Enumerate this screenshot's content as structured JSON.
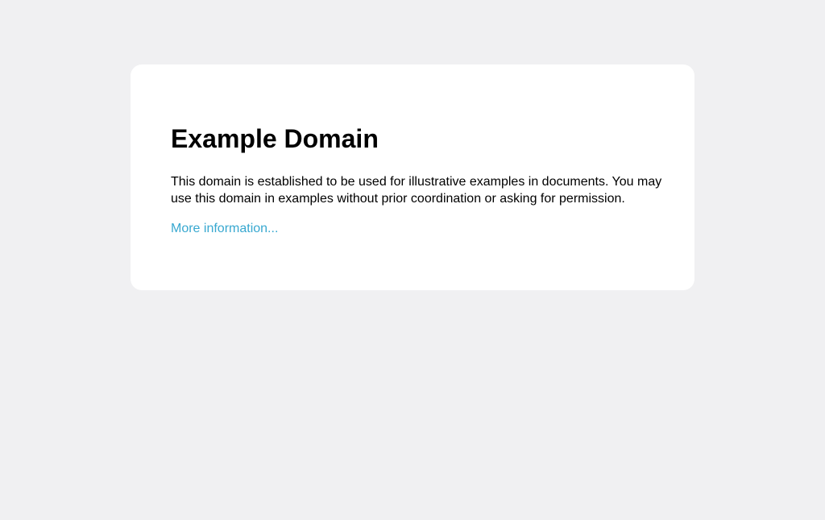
{
  "page": {
    "title": "Example Domain",
    "description": "This domain is established to be used for illustrative examples in documents. You may use this domain in examples without prior coordination or asking for permission.",
    "link_label": "More information..."
  },
  "colors": {
    "background": "#f0f0f2",
    "card": "#ffffff",
    "link": "#38a8d0"
  }
}
